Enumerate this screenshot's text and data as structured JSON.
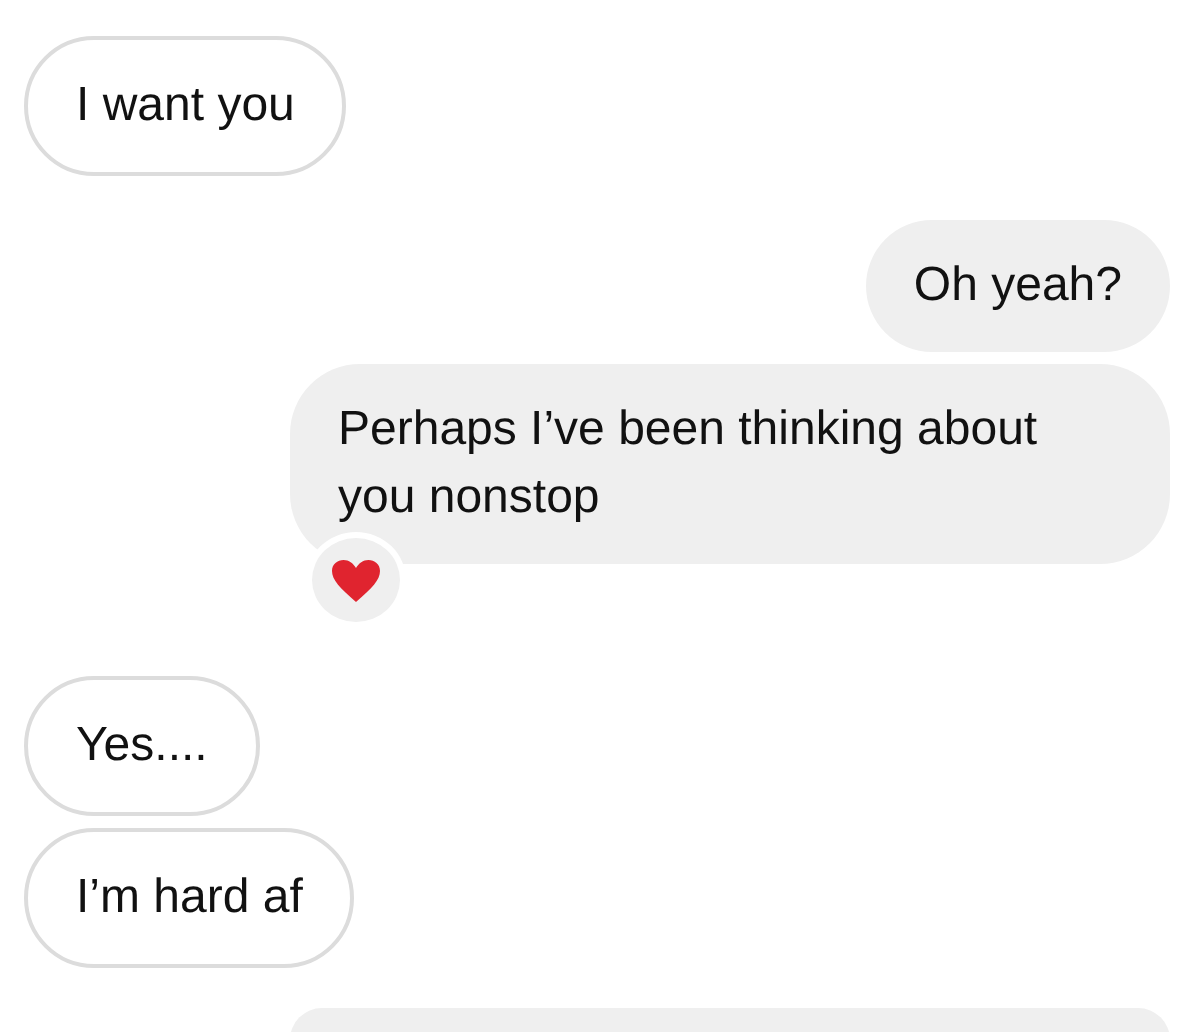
{
  "messages": [
    {
      "kind": "incoming",
      "text": "I want you"
    },
    {
      "kind": "outgoing",
      "text": "Oh yeah?"
    },
    {
      "kind": "outgoing",
      "text": "Perhaps I’ve been thinking about you nonstop",
      "liked": true
    },
    {
      "kind": "incoming",
      "text": "Yes...."
    },
    {
      "kind": "incoming",
      "text": "I’m hard af"
    },
    {
      "kind": "outgoing"
    }
  ]
}
